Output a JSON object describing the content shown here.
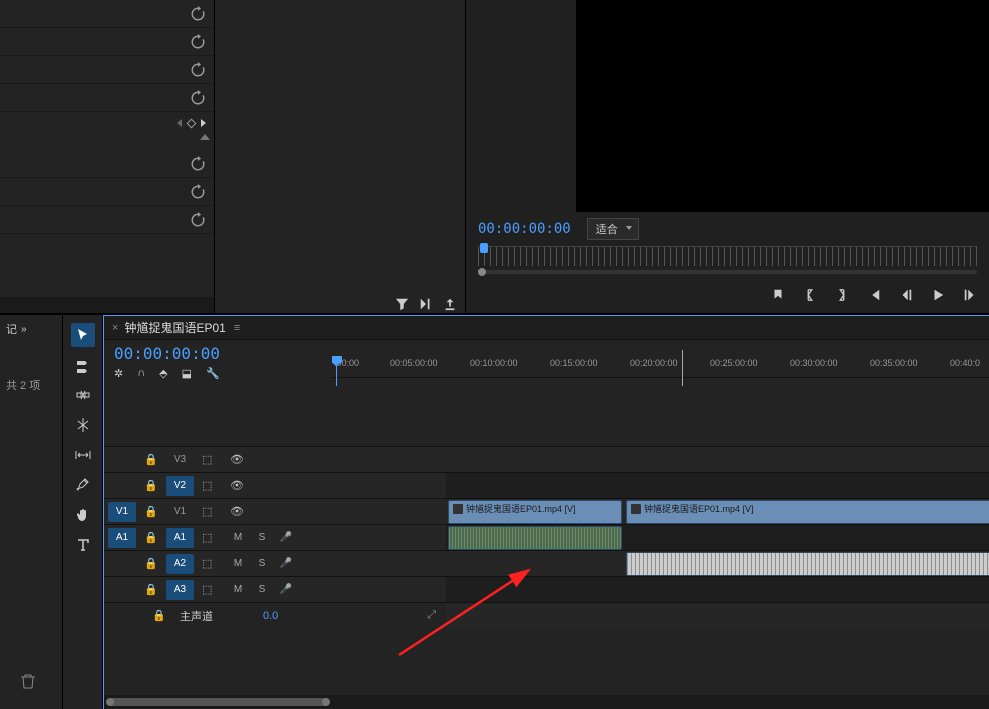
{
  "monitor": {
    "timecode": "00:00:00:00",
    "fit_label": "适合"
  },
  "project": {
    "tab_label": "记",
    "count_label": "共 2 项"
  },
  "timeline": {
    "sequence_name": "钟馗捉鬼国语EP01",
    "timecode": "00:00:00:00",
    "ruler_ticks": [
      ":00:00",
      "00:05:00:00",
      "00:10:00:00",
      "00:15:00:00",
      "00:20:00:00",
      "00:25:00:00",
      "00:30:00:00",
      "00:35:00:00",
      "00:40:0"
    ],
    "tracks": {
      "v3": {
        "label": "V3"
      },
      "v2": {
        "label": "V2"
      },
      "v1_src": {
        "label": "V1"
      },
      "v1_tgt": {
        "label": "V1"
      },
      "a1_src": {
        "label": "A1"
      },
      "a1_tgt": {
        "label": "A1"
      },
      "a2": {
        "label": "A2"
      },
      "a3": {
        "label": "A3"
      },
      "m_label": "M",
      "s_label": "S"
    },
    "master": {
      "label": "主声道",
      "db": "0.0"
    },
    "clips": {
      "v1a": "钟馗捉鬼国语EP01.mp4 [V]",
      "v1b": "钟馗捉鬼国语EP01.mp4 [V]"
    }
  }
}
